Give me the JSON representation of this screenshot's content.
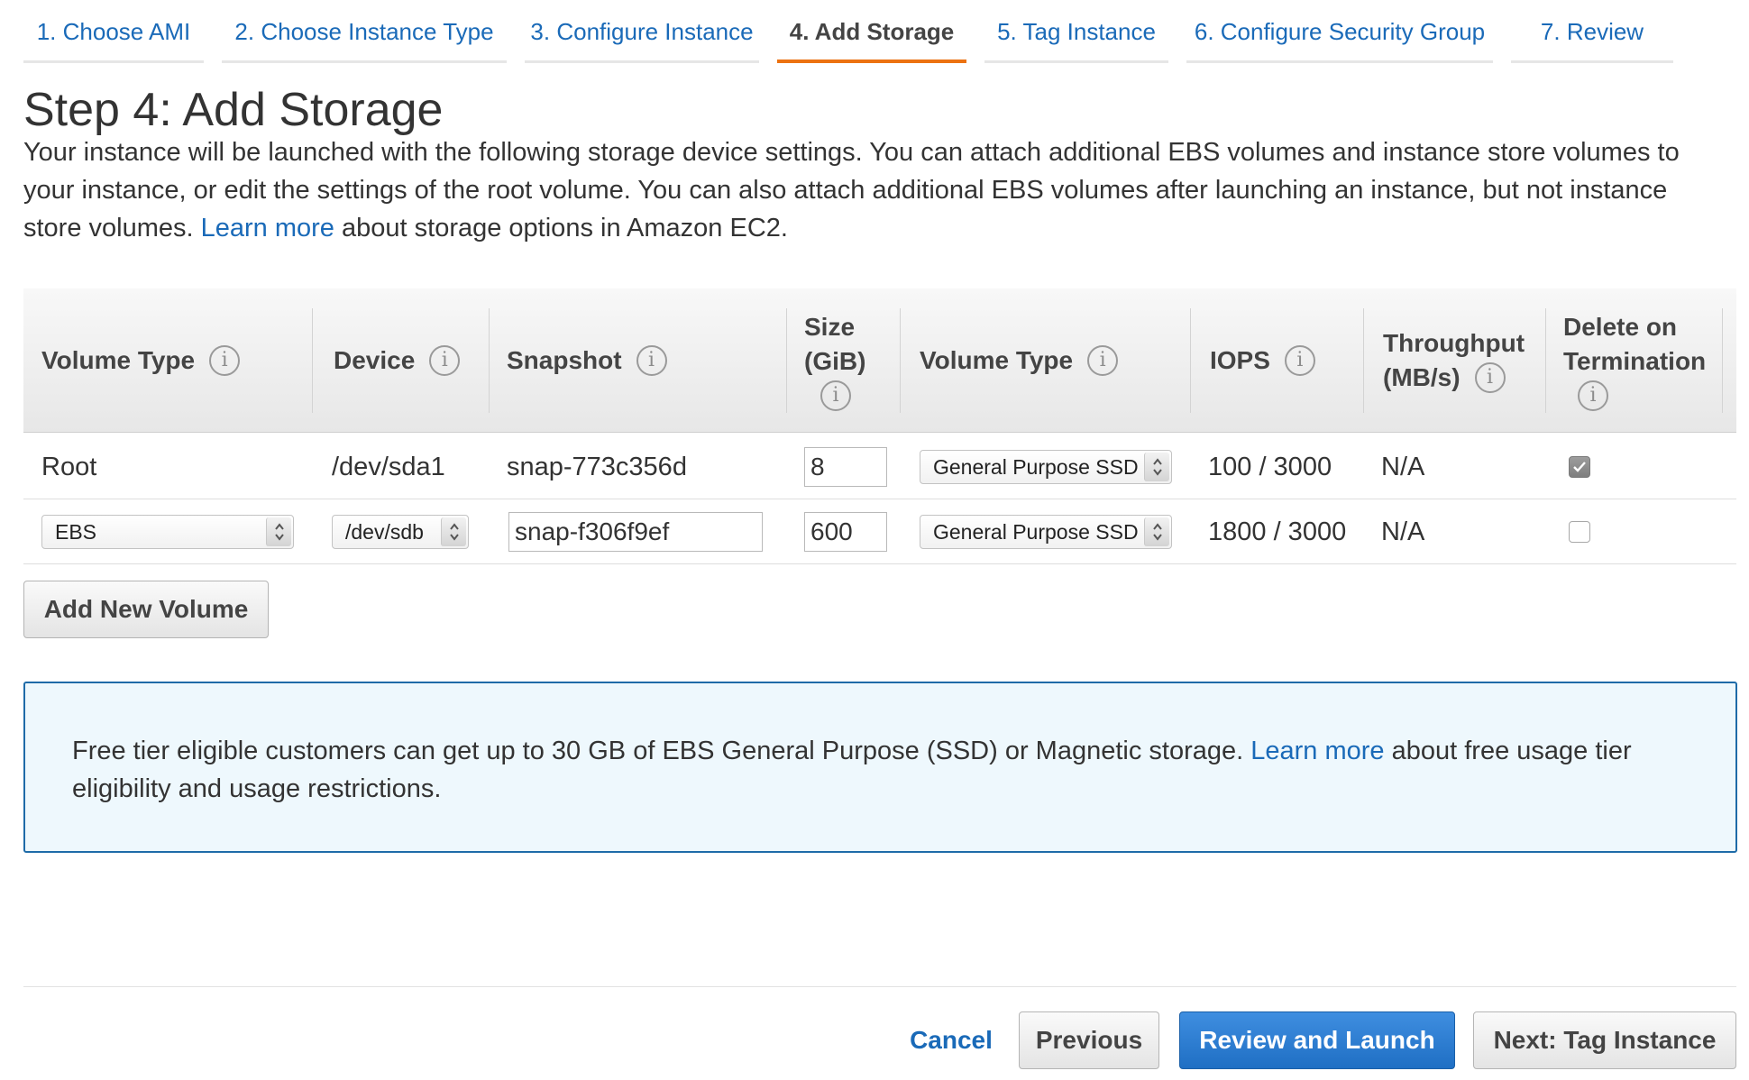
{
  "tabs": [
    {
      "label": "1. Choose AMI"
    },
    {
      "label": "2. Choose Instance Type"
    },
    {
      "label": "3. Configure Instance"
    },
    {
      "label": "4. Add Storage"
    },
    {
      "label": "5. Tag Instance"
    },
    {
      "label": "6. Configure Security Group"
    },
    {
      "label": "7. Review"
    }
  ],
  "active_tab": "4. Add Storage",
  "page": {
    "title": "Step 4: Add Storage",
    "intro_text": "Your instance will be launched with the following storage device settings. You can attach additional EBS volumes and instance store volumes to your instance, or edit the settings of the root volume. You can also attach additional EBS volumes after launching an instance, but not instance store volumes.",
    "intro_link": "Learn more",
    "intro_suffix": "about storage options in Amazon EC2."
  },
  "table": {
    "headers": {
      "volume_type": "Volume Type",
      "device": "Device",
      "snapshot": "Snapshot",
      "size_line1": "Size",
      "size_line2": "(GiB)",
      "ebs_volume_type": "Volume Type",
      "iops": "IOPS",
      "throughput_line1": "Throughput",
      "throughput_line2": "(MB/s)",
      "delete_line1": "Delete on",
      "delete_line2": "Termination"
    },
    "rows": [
      {
        "volume_type": "Root",
        "device": "/dev/sda1",
        "snapshot": "snap-773c356d",
        "size": "8",
        "ebs_volume_type": "General Purpose SSD",
        "iops": "100 / 3000",
        "throughput": "N/A",
        "delete_on_termination": true
      },
      {
        "volume_type": "EBS",
        "device": "/dev/sdb",
        "snapshot": "snap-f306f9ef",
        "size": "600",
        "ebs_volume_type": "General Purpose SSD",
        "iops": "1800 / 3000",
        "throughput": "N/A",
        "delete_on_termination": false
      }
    ]
  },
  "add_volume_label": "Add New Volume",
  "notice": {
    "text": "Free tier eligible customers can get up to 30 GB of EBS General Purpose (SSD) or Magnetic storage.",
    "link": "Learn more",
    "suffix": "about free usage tier eligibility and usage restrictions."
  },
  "footer": {
    "cancel": "Cancel",
    "previous": "Previous",
    "review_launch": "Review and Launch",
    "next": "Next: Tag Instance"
  },
  "colors": {
    "link": "#1a6ab8",
    "active_tab_underline": "#ec7211",
    "primary_button": "#2e7fd4",
    "notice_background": "#eef8fd",
    "notice_border": "#1e6ba8"
  }
}
